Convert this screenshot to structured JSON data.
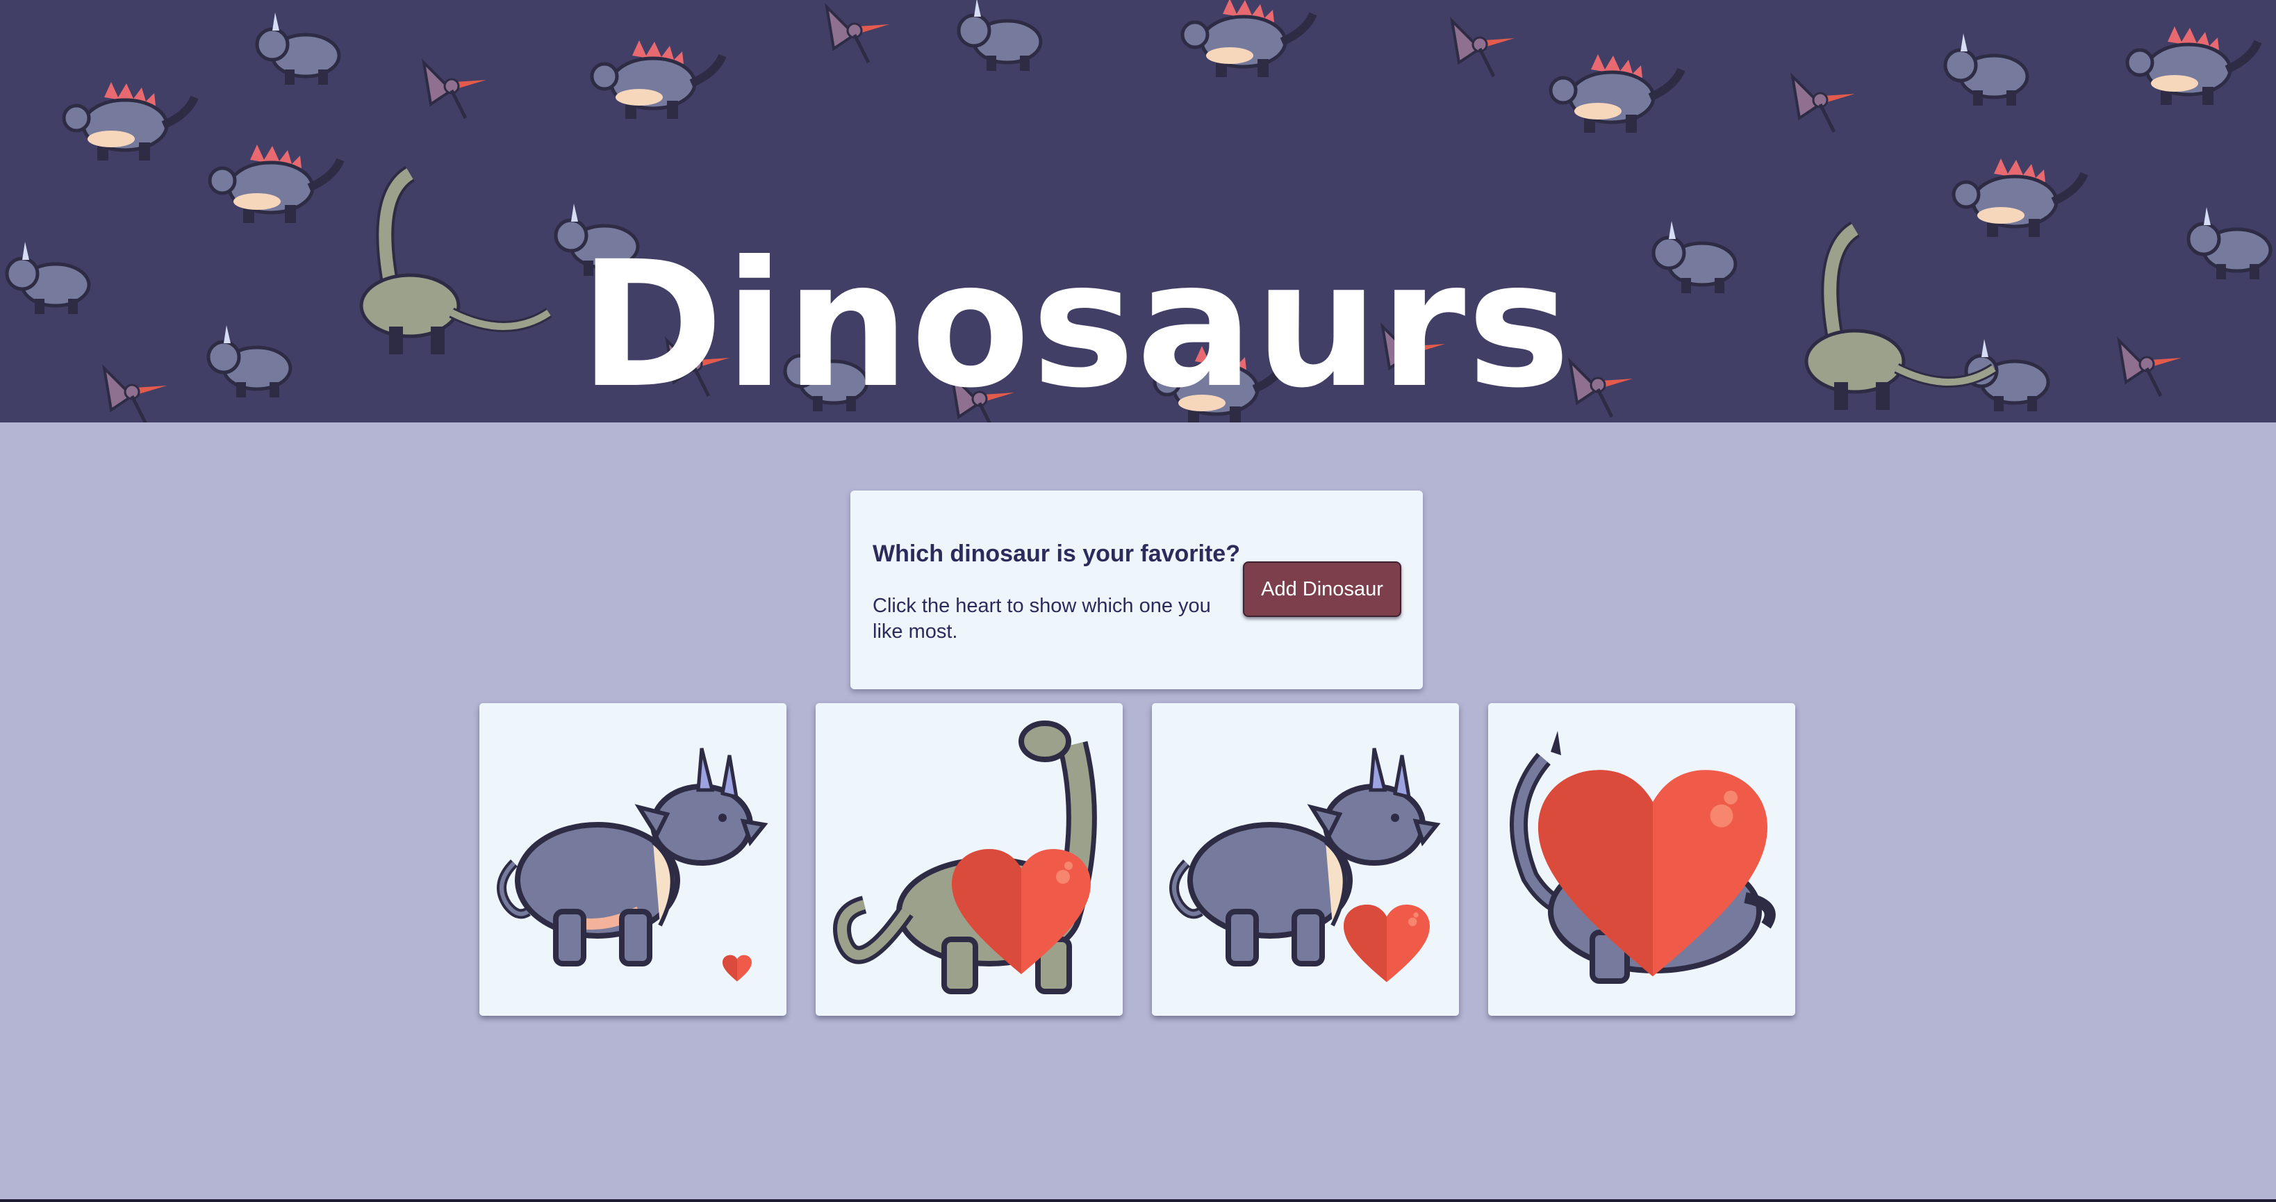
{
  "header": {
    "title": "Dinosaurs"
  },
  "intro": {
    "heading": "Which dinosaur is your favorite?",
    "description": "Click the heart to show which one you like most.",
    "add_button_label": "Add Dinosaur"
  },
  "cards": [
    {
      "dinosaur_icon": "triceratops-icon",
      "heart_level": "small"
    },
    {
      "dinosaur_icon": "brachiosaurus-icon",
      "heart_level": "large"
    },
    {
      "dinosaur_icon": "triceratops-icon",
      "heart_level": "medium"
    },
    {
      "dinosaur_icon": "brachiosaurus-icon",
      "heart_level": "extra-large"
    }
  ],
  "colors": {
    "banner_background": "#423f67",
    "page_background": "#b4b5d3",
    "card_background": "#eef5fb",
    "button_background": "#7e3f4c",
    "heart": "#f05a48",
    "heading_text": "#2d2a5c"
  }
}
